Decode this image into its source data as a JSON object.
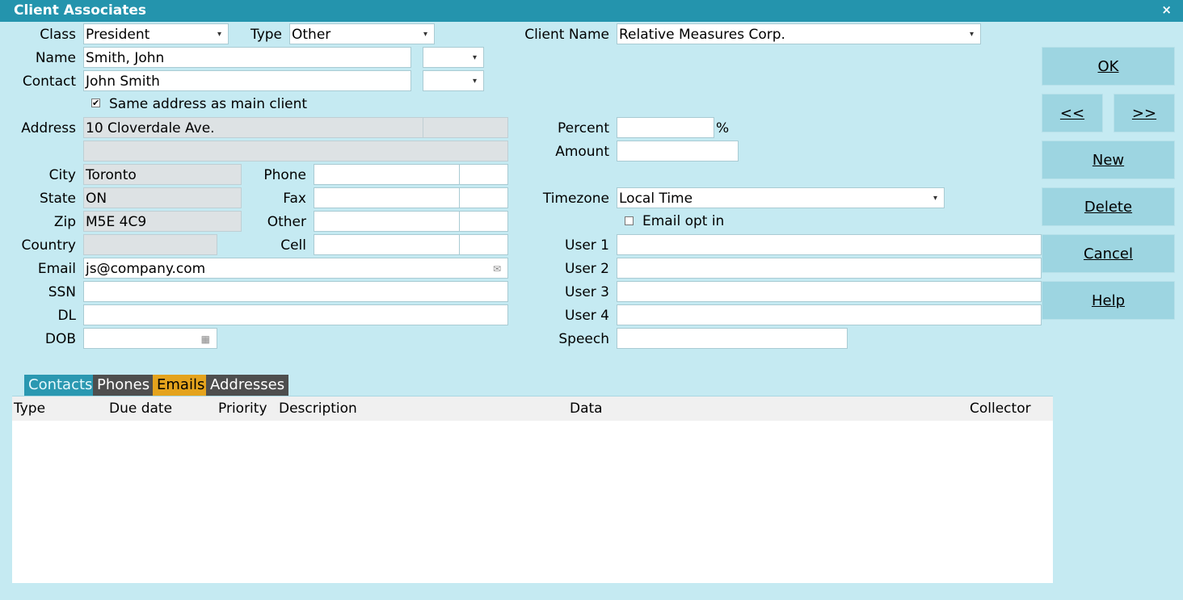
{
  "window": {
    "title": "Client Associates",
    "close_label": "×"
  },
  "labels": {
    "class": "Class",
    "type": "Type",
    "client_name": "Client Name",
    "name": "Name",
    "contact": "Contact",
    "same_address": "Same address as main client",
    "address": "Address",
    "city": "City",
    "state": "State",
    "zip": "Zip",
    "country": "Country",
    "email": "Email",
    "ssn": "SSN",
    "dl": "DL",
    "dob": "DOB",
    "phone": "Phone",
    "fax": "Fax",
    "other": "Other",
    "cell": "Cell",
    "percent": "Percent",
    "percent_unit": "%",
    "amount": "Amount",
    "timezone": "Timezone",
    "email_opt_in": "Email opt in",
    "user1": "User 1",
    "user2": "User 2",
    "user3": "User 3",
    "user4": "User 4",
    "speech": "Speech"
  },
  "values": {
    "class": "President",
    "type": "Other",
    "client_name": "Relative Measures Corp.",
    "name": "Smith, John",
    "contact": "John Smith",
    "address1": "10 Cloverdale Ave.",
    "city": "Toronto",
    "state": "ON",
    "zip": "M5E 4C9",
    "email": "js@company.com",
    "timezone": "Local Time"
  },
  "checks": {
    "same_address": "✔",
    "email_opt_in": ""
  },
  "buttons": {
    "ok": "OK",
    "prev": "<<",
    "next": ">>",
    "new": "New",
    "delete": "Delete",
    "cancel": "Cancel",
    "help": "Help"
  },
  "tabs": [
    "Contacts",
    "Phones",
    "Emails",
    "Addresses"
  ],
  "grid_columns": [
    "Type",
    "Due date",
    "Priority",
    "Description",
    "Data",
    "Collector"
  ],
  "icons": {
    "dropdown": "▾",
    "email": "✉",
    "calendar": "▦"
  }
}
